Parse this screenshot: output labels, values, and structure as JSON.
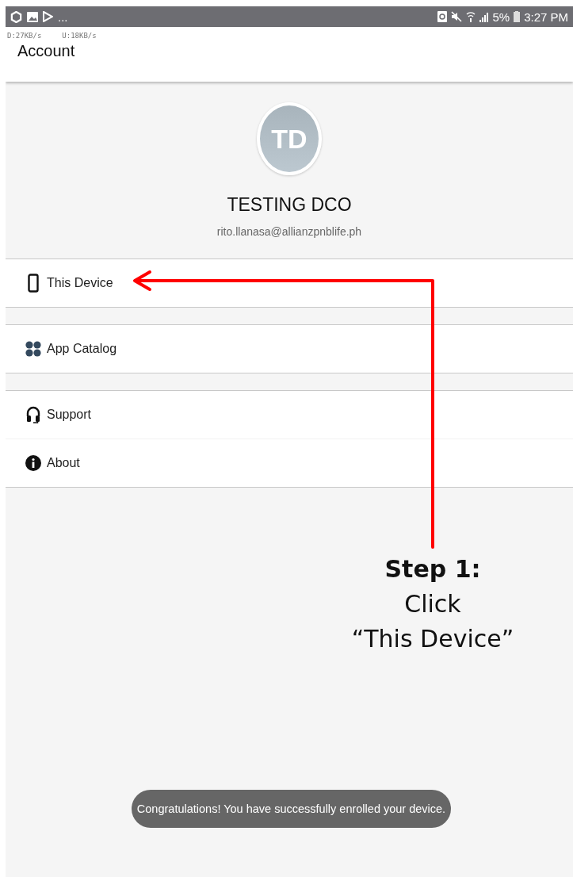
{
  "status_bar": {
    "left_more": "...",
    "battery": "5%",
    "time": "3:27 PM"
  },
  "net_speed": {
    "download": "D:27KB/s",
    "upload": "U:18KB/s"
  },
  "header": {
    "title": "Account"
  },
  "profile": {
    "initials": "TD",
    "name": "TESTING DCO",
    "email": "rito.llanasa@allianzpnblife.ph"
  },
  "menu_groups": [
    {
      "items": [
        {
          "label": "This Device"
        }
      ]
    },
    {
      "items": [
        {
          "label": "App Catalog"
        }
      ]
    },
    {
      "items": [
        {
          "label": "Support"
        },
        {
          "label": "About"
        }
      ]
    }
  ],
  "annotation": {
    "lines": [
      "Step 1:",
      "Click",
      "“This Device”"
    ]
  },
  "toast": {
    "text": "Congratulations! You have successfully enrolled your device."
  }
}
